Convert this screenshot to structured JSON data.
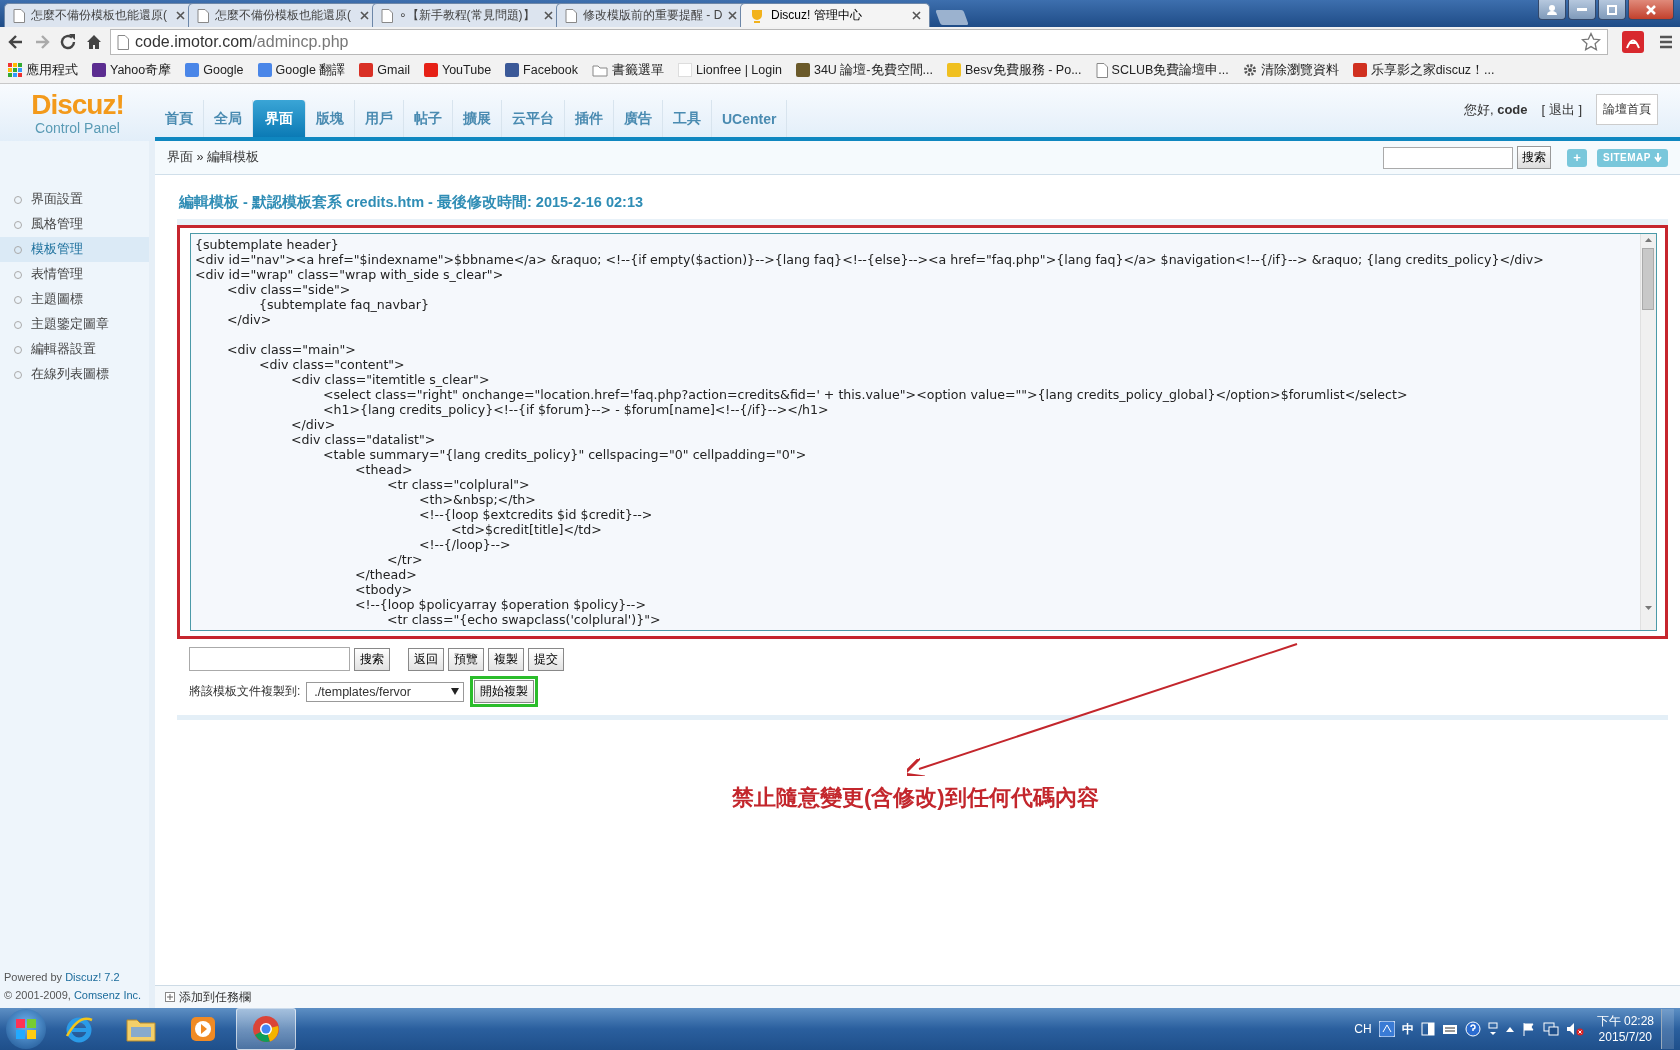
{
  "browser": {
    "tabs": [
      {
        "title": "怎麼不備份模板也能還原(",
        "selected": false
      },
      {
        "title": "怎麼不備份模板也能還原(",
        "selected": false
      },
      {
        "title": "∘【新手教程(常見問題)】",
        "selected": false
      },
      {
        "title": "修改模版前的重要提醒 - D",
        "selected": false
      },
      {
        "title": "Discuz! 管理中心",
        "selected": true
      }
    ],
    "address": {
      "host": "code.imotor.com",
      "path": "/admincp.php"
    },
    "bookmarks": [
      {
        "kind": "apps",
        "label": "應用程式"
      },
      {
        "kind": "site",
        "label": "Yahoo奇摩",
        "color": "#5c2d91"
      },
      {
        "kind": "site",
        "label": "Google",
        "color": "#4a86e8"
      },
      {
        "kind": "site",
        "label": "Google 翻譯",
        "color": "#4a86e8"
      },
      {
        "kind": "site",
        "label": "Gmail",
        "color": "#d93025"
      },
      {
        "kind": "site",
        "label": "YouTube",
        "color": "#e62117"
      },
      {
        "kind": "site",
        "label": "Facebook",
        "color": "#3b5998"
      },
      {
        "kind": "folder",
        "label": "書籤選單"
      },
      {
        "kind": "blank",
        "label": "Lionfree | Login"
      },
      {
        "kind": "site",
        "label": "34U 論壇-免費空間...",
        "color": "#6b5a2a"
      },
      {
        "kind": "site",
        "label": "Besv免費服務 - Po...",
        "color": "#f0c020"
      },
      {
        "kind": "page",
        "label": "SCLUB免費論壇申..."
      },
      {
        "kind": "gear",
        "label": "清除瀏覽資料"
      },
      {
        "kind": "site",
        "label": "乐享影之家discuz！...",
        "color": "#d03020"
      }
    ]
  },
  "header": {
    "logo": "Discuz!",
    "subtitle": "Control Panel",
    "nav": [
      {
        "label": "首頁",
        "selected": false
      },
      {
        "label": "全局",
        "selected": false
      },
      {
        "label": "界面",
        "selected": true
      },
      {
        "label": "版塊",
        "selected": false
      },
      {
        "label": "用戶",
        "selected": false
      },
      {
        "label": "帖子",
        "selected": false
      },
      {
        "label": "擴展",
        "selected": false
      },
      {
        "label": "云平台",
        "selected": false
      },
      {
        "label": "插件",
        "selected": false
      },
      {
        "label": "廣告",
        "selected": false
      },
      {
        "label": "工具",
        "selected": false
      },
      {
        "label": "UCenter",
        "selected": false
      }
    ],
    "greeting": "您好,",
    "user": "code",
    "logout": "[ 退出 ]",
    "home_button": "論壇首頁"
  },
  "breadcrumb": "界面 » 編輯模板",
  "top_search": {
    "button": "搜索",
    "plus": "+",
    "sitemap": "SITEMAP"
  },
  "sidebar": {
    "items": [
      {
        "label": "界面設置",
        "selected": false
      },
      {
        "label": "風格管理",
        "selected": false
      },
      {
        "label": "模板管理",
        "selected": true
      },
      {
        "label": "表情管理",
        "selected": false
      },
      {
        "label": "主題圖標",
        "selected": false
      },
      {
        "label": "主題鑒定圖章",
        "selected": false
      },
      {
        "label": "編輯器設置",
        "selected": false
      },
      {
        "label": "在線列表圖標",
        "selected": false
      }
    ],
    "powered": "Powered by ",
    "powered_link": "Discuz! 7.2",
    "copyright": "© 2001-2009, ",
    "company": "Comsenz Inc."
  },
  "main": {
    "title": "編輯模板 - 默認模板套系 credits.htm - 最後修改時間: 2015-2-16 02:13",
    "editor": {
      "highlighted": true,
      "value": "{subtemplate header}\n<div id=\"nav\"><a href=\"$indexname\">$bbname</a> &raquo; <!--{if empty($action)}-->{lang faq}<!--{else}--><a href=\"faq.php\">{lang faq}</a> $navigation<!--{/if}--> &raquo; {lang credits_policy}</div>\n<div id=\"wrap\" class=\"wrap with_side s_clear\">\n\t<div class=\"side\">\n\t\t{subtemplate faq_navbar}\n\t</div>\n\n\t<div class=\"main\">\n\t\t<div class=\"content\">\n\t\t\t<div class=\"itemtitle s_clear\">\n\t\t\t\t<select class=\"right\" onchange=\"location.href='faq.php?action=credits&fid=' + this.value\"><option value=\"\">{lang credits_policy_global}</option>$forumlist</select>\n\t\t\t\t<h1>{lang credits_policy}<!--{if $forum}--> - $forum[name]<!--{/if}--></h1>\n\t\t\t</div>\n\t\t\t<div class=\"datalist\">\n\t\t\t\t<table summary=\"{lang credits_policy}\" cellspacing=\"0\" cellpadding=\"0\">\n\t\t\t\t\t<thead>\n\t\t\t\t\t\t<tr class=\"colplural\">\n\t\t\t\t\t\t\t<th>&nbsp;</th>\n\t\t\t\t\t\t\t<!--{loop $extcredits $id $credit}-->\n\t\t\t\t\t\t\t\t<td>$credit[title]</td>\n\t\t\t\t\t\t\t<!--{/loop}-->\n\t\t\t\t\t\t</tr>\n\t\t\t\t\t</thead>\n\t\t\t\t\t<tbody>\n\t\t\t\t\t<!--{loop $policyarray $operation $policy}-->\n\t\t\t\t\t\t<tr class=\"{echo swapclass('colplural')}\">"
    },
    "search_button": "搜索",
    "actions": [
      "返回",
      "預覽",
      "複製",
      "提交"
    ],
    "copy_label": "將該模板文件複製到:",
    "copy_target": "./templates/fervor",
    "copy_button": {
      "label": "開始複製",
      "highlighted": true
    },
    "annotation": "禁止隨意變更(含修改)到任何代碼內容",
    "taskbar_add": "添加到任務欄"
  },
  "taskbar": {
    "apps": [
      {
        "kind": "ie",
        "selected": false
      },
      {
        "kind": "folder",
        "selected": false
      },
      {
        "kind": "media",
        "selected": false
      },
      {
        "kind": "chrome",
        "selected": true
      }
    ],
    "language": "CH",
    "ime": "中",
    "time": "下午 02:28",
    "date": "2015/7/20"
  }
}
